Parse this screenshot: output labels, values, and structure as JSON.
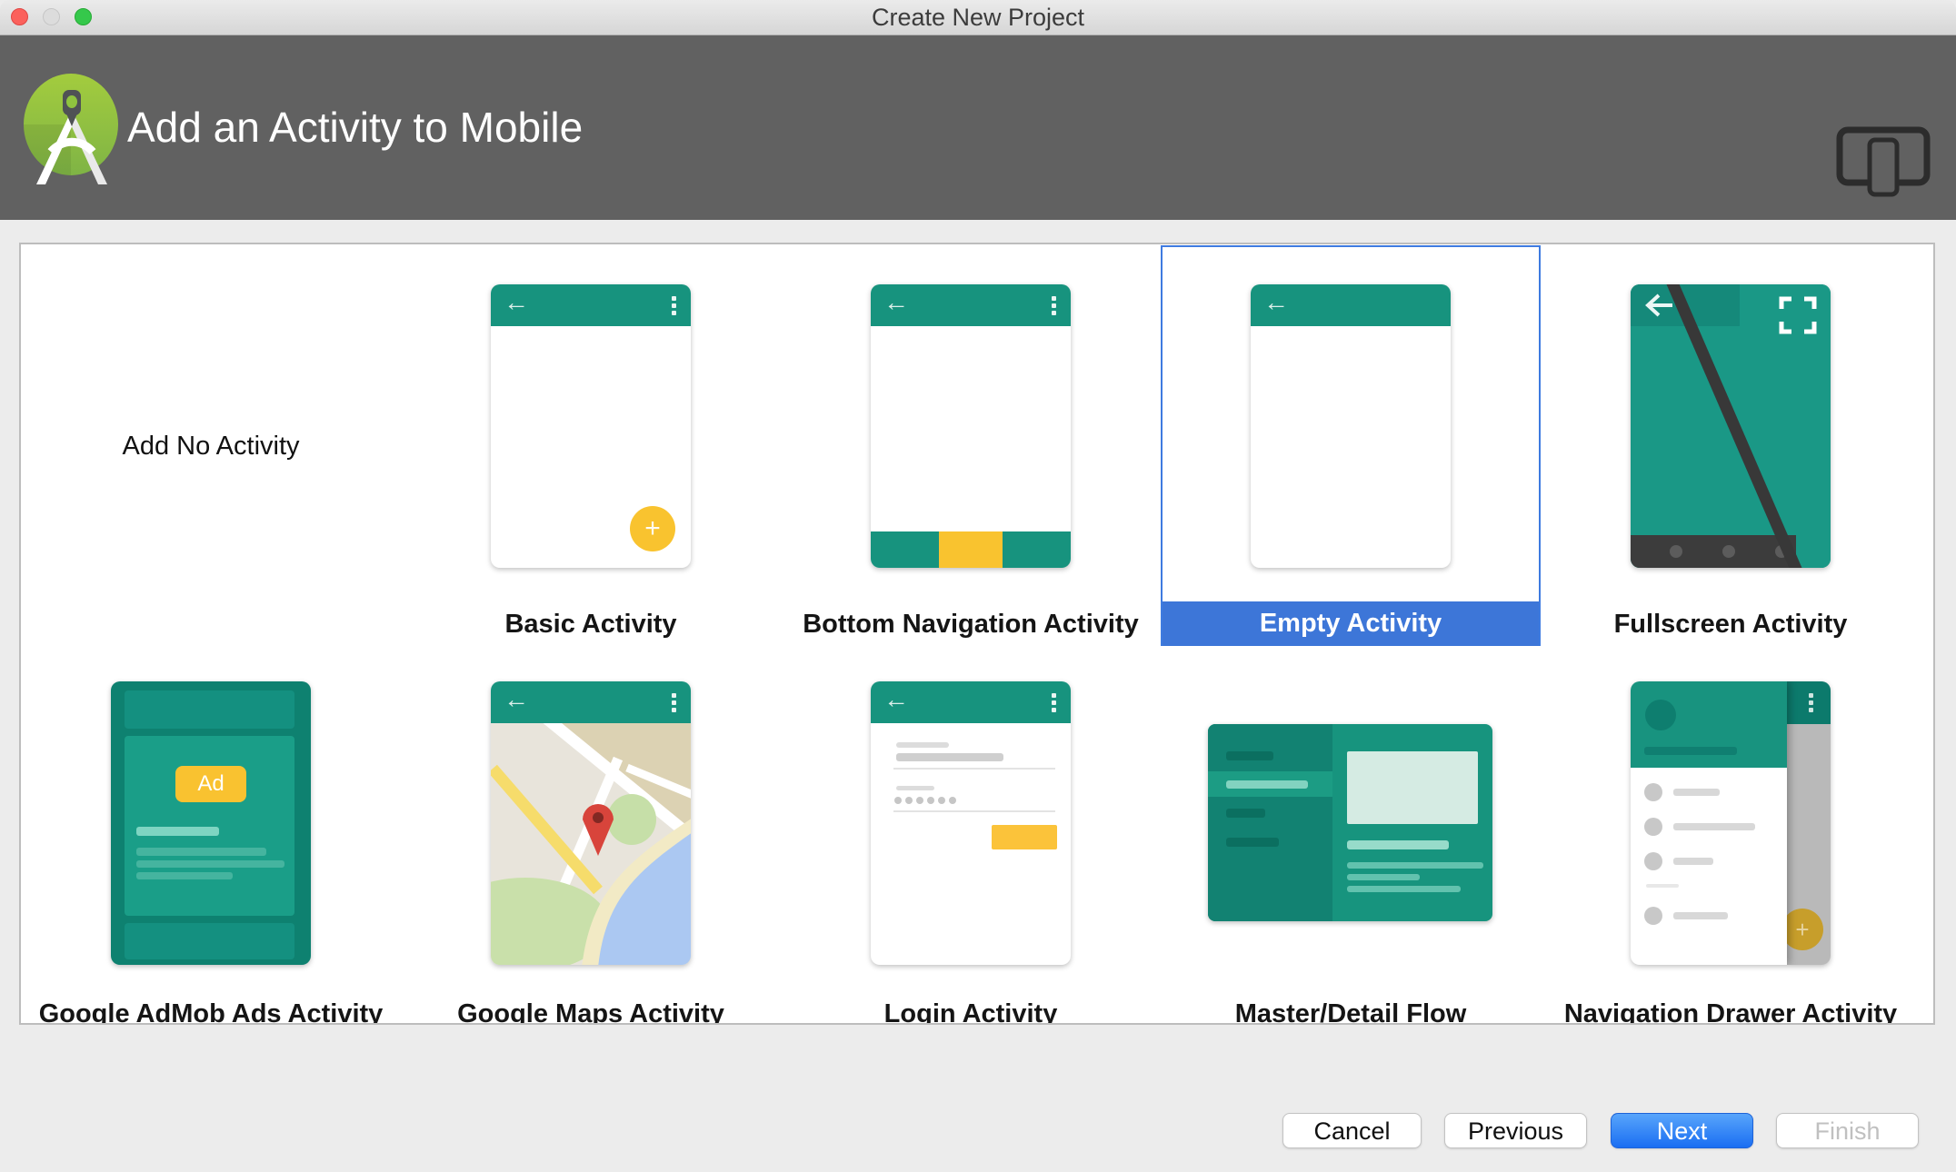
{
  "window": {
    "title": "Create New Project"
  },
  "header": {
    "title": "Add an Activity to Mobile"
  },
  "gallery": {
    "items": [
      {
        "label": "Add No Activity",
        "selected": false
      },
      {
        "label": "Basic Activity",
        "selected": false
      },
      {
        "label": "Bottom Navigation Activity",
        "selected": false
      },
      {
        "label": "Empty Activity",
        "selected": true
      },
      {
        "label": "Fullscreen Activity",
        "selected": false
      },
      {
        "label": "Google AdMob Ads Activity",
        "selected": false
      },
      {
        "label": "Google Maps Activity",
        "selected": false
      },
      {
        "label": "Login Activity",
        "selected": false
      },
      {
        "label": "Master/Detail Flow",
        "selected": false
      },
      {
        "label": "Navigation Drawer Activity",
        "selected": false
      }
    ]
  },
  "thumbnails": {
    "admob_ad_label": "Ad",
    "fab_plus": "+"
  },
  "footer": {
    "buttons": [
      {
        "label": "Cancel",
        "style": "normal"
      },
      {
        "label": "Previous",
        "style": "normal"
      },
      {
        "label": "Next",
        "style": "primary"
      },
      {
        "label": "Finish",
        "style": "disabled"
      }
    ]
  },
  "colors": {
    "teal": "#17937E",
    "accent_yellow": "#F9C32F",
    "selection_blue": "#3D76D8",
    "header_gray": "#616161"
  }
}
